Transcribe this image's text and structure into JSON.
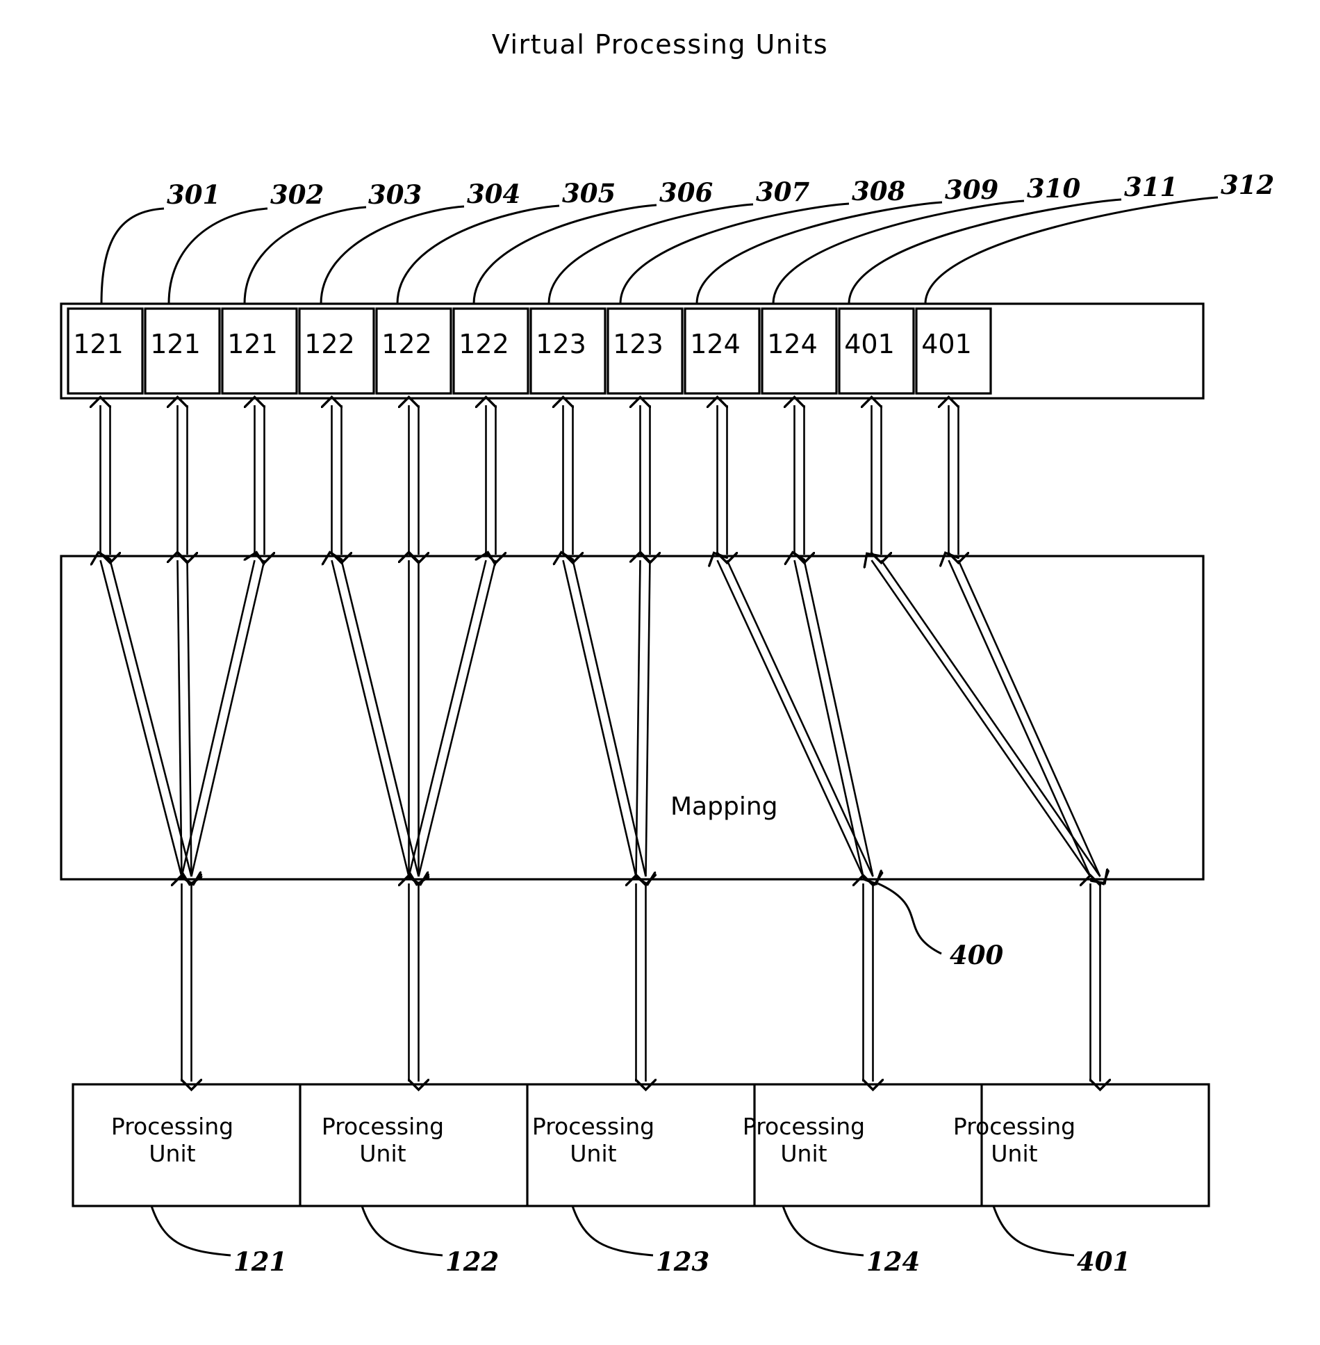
{
  "title": "Virtual Processing Units",
  "mapping": {
    "label": "Mapping",
    "ref": "400"
  },
  "virtual_units": {
    "refs": [
      "301",
      "302",
      "303",
      "304",
      "305",
      "306",
      "307",
      "308",
      "309",
      "310",
      "311",
      "312"
    ],
    "values": [
      "121",
      "121",
      "121",
      "122",
      "122",
      "122",
      "123",
      "123",
      "124",
      "124",
      "401",
      "401"
    ]
  },
  "processing_units": {
    "label_line1": "Processing",
    "label_line2": "Unit",
    "refs": [
      "121",
      "122",
      "123",
      "124",
      "401"
    ],
    "items": [
      {
        "line1": "Processing",
        "line2": "Unit",
        "ref": "121"
      },
      {
        "line1": "Processing",
        "line2": "Unit",
        "ref": "122"
      },
      {
        "line1": "Processing",
        "line2": "Unit",
        "ref": "123"
      },
      {
        "line1": "Processing",
        "line2": "Unit",
        "ref": "124"
      },
      {
        "line1": "Processing",
        "line2": "Unit",
        "ref": "401"
      }
    ]
  },
  "colors": {
    "ink": "#000000",
    "background": "#ffffff"
  }
}
